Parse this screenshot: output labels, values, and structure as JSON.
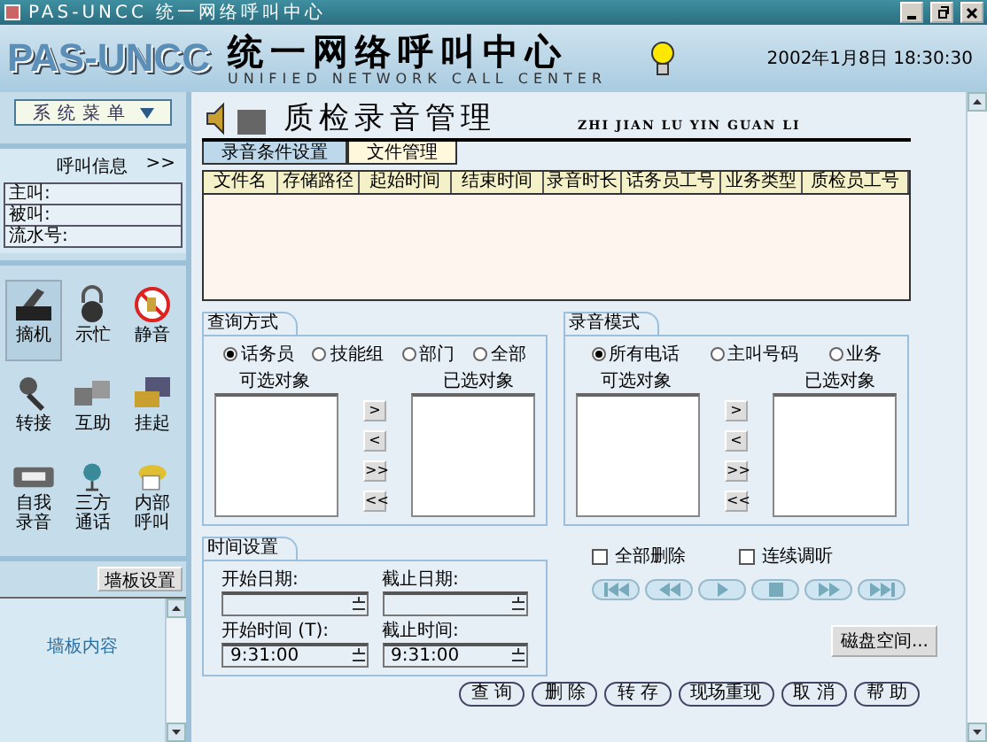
{
  "window": {
    "title": "PAS-UNCC  统一网络呼叫中心"
  },
  "header": {
    "logo": "PAS-UNCC",
    "title": "统一网络呼叫中心",
    "subtitle": "UNIFIED NETWORK CALL CENTER",
    "datetime": "2002年1月8日  18:30:30"
  },
  "sidebar": {
    "menu_button": "系统菜单",
    "call_info": {
      "title": "呼叫信息",
      "toggle": ">>",
      "fields": [
        "主叫:",
        "被叫:",
        "流水号:"
      ]
    },
    "actions": [
      {
        "label": "摘机",
        "selected": true
      },
      {
        "label": "示忙",
        "selected": false
      },
      {
        "label": "静音",
        "selected": false
      },
      {
        "label": "转接",
        "selected": false
      },
      {
        "label": "互助",
        "selected": false
      },
      {
        "label": "挂起",
        "selected": false
      },
      {
        "label": "自我录音",
        "selected": false
      },
      {
        "label": "三方通话",
        "selected": false
      },
      {
        "label": "内部呼叫",
        "selected": false
      }
    ],
    "board_button": "墙板设置",
    "board_content": "墙板内容"
  },
  "page": {
    "title": "质检录音管理",
    "pinyin": "ZHI JIAN LU YIN GUAN LI",
    "tabs": [
      {
        "label": "录音条件设置",
        "selected": false
      },
      {
        "label": "文件管理",
        "selected": true
      }
    ],
    "table": {
      "columns": [
        "文件名",
        "存储路径",
        "起始时间",
        "结束时间",
        "录音时长",
        "话务员工号",
        "业务类型",
        "质检员工号"
      ]
    },
    "panels": [
      {
        "title": "查询方式",
        "options": [
          {
            "label": "话务员",
            "selected": true
          },
          {
            "label": "技能组",
            "selected": false
          },
          {
            "label": "部门",
            "selected": false
          },
          {
            "label": "全部",
            "selected": false
          }
        ],
        "available_label": "可选对象",
        "chosen_label": "已选对象",
        "transfer_buttons": [
          ">",
          "<",
          ">>",
          "<<"
        ]
      },
      {
        "title": "录音模式",
        "options": [
          {
            "label": "所有电话",
            "selected": true
          },
          {
            "label": "主叫号码",
            "selected": false
          },
          {
            "label": "业务",
            "selected": false
          }
        ],
        "available_label": "可选对象",
        "chosen_label": "已选对象",
        "transfer_buttons": [
          ">",
          "<",
          ">>",
          "<<"
        ]
      }
    ],
    "time": {
      "title": "时间设置",
      "fields": [
        {
          "label": "开始日期:"
        },
        {
          "label": "截止日期:"
        },
        {
          "label": "开始时间 (T):",
          "value": "9:31:00"
        },
        {
          "label": "截止时间:",
          "value": "9:31:00"
        }
      ]
    },
    "checks": [
      {
        "label": "全部删除",
        "checked": false
      },
      {
        "label": "连续调听",
        "checked": false
      }
    ],
    "disk_button": "磁盘空间...",
    "buttons": [
      "查 询",
      "删 除",
      "转 存",
      "现场重现",
      "取 消",
      "帮 助"
    ]
  }
}
